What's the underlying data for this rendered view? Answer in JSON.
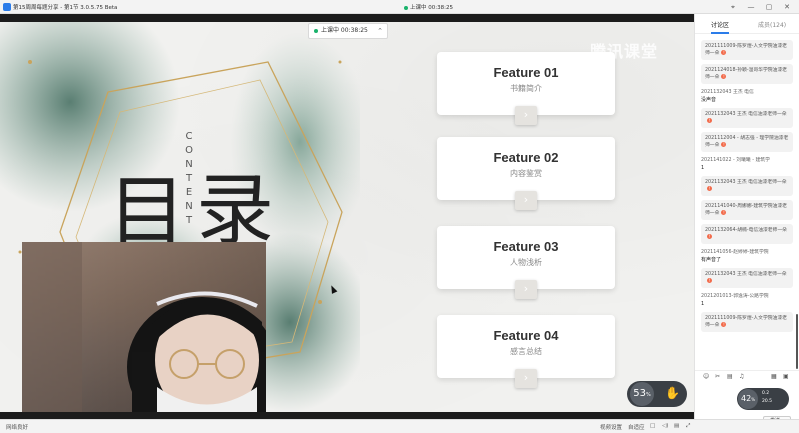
{
  "titlebar": {
    "title": "第15周周每题分享 - 第1节  3.0.5.75 Beta",
    "status": "上课中 00:38:25",
    "controls": [
      "⌖",
      "—",
      "▢",
      "✕"
    ]
  },
  "slide": {
    "timer": "上课中 00:38:25",
    "vertical_text": [
      "C",
      "O",
      "N",
      "T",
      "E",
      "N",
      "T"
    ],
    "big_chars": [
      "目",
      "录"
    ],
    "watermark": "腾讯课堂",
    "features": [
      {
        "title": "Feature 01",
        "subtitle": "书籍简介"
      },
      {
        "title": "Feature 02",
        "subtitle": "内容鉴赏"
      },
      {
        "title": "Feature 03",
        "subtitle": "人物浅析"
      },
      {
        "title": "Feature 04",
        "subtitle": "感言总结"
      }
    ]
  },
  "panel": {
    "tabs": [
      "讨论区",
      "成员(124)"
    ],
    "messages": [
      {
        "kind": "bubble",
        "text": "2021111009-陈罗煜-人文学院油漆老师一朵",
        "warn": true
      },
      {
        "kind": "bubble",
        "text": "2021124018-孙颖-温哥华学院油漆老师一朵",
        "warn": true
      },
      {
        "kind": "name",
        "text": "2021132043 王杰 电信"
      },
      {
        "kind": "plain",
        "text": "没声音"
      },
      {
        "kind": "bubble",
        "text": "2021132043 王杰 电信油漆老师一朵",
        "warn": true
      },
      {
        "kind": "bubble",
        "text": "2021112004 - 胡志强 - 理学院油漆老师一朵",
        "warn": true
      },
      {
        "kind": "name",
        "text": "2021141022 - 刘曦曦 - 建筑学"
      },
      {
        "kind": "plain",
        "text": "1"
      },
      {
        "kind": "bubble",
        "text": "2021132043 王杰 电信油漆老师一朵",
        "warn": true
      },
      {
        "kind": "bubble",
        "text": "2021141040-周娜娜-建筑学院油漆老师一朵",
        "warn": true
      },
      {
        "kind": "bubble",
        "text": "2021132064-胡楠-电信油漆老师一朵",
        "warn": true
      },
      {
        "kind": "name",
        "text": "2021141056-赵婷婷-建筑学院"
      },
      {
        "kind": "plain",
        "text": "有声音了"
      },
      {
        "kind": "bubble",
        "text": "2021132043 王杰 电信油漆老师一朵",
        "warn": true
      },
      {
        "kind": "name",
        "text": "2021201013-郭逸涛-公路学院"
      },
      {
        "kind": "plain",
        "text": "1"
      },
      {
        "kind": "bubble",
        "text": "2021111009-陈罗煜-人文学院油漆老师一朵",
        "warn": true
      }
    ],
    "tools": [
      "☺",
      "✂",
      "▤",
      "♫",
      "▦",
      "▣"
    ],
    "progress_count": "42",
    "progress_unit": "%",
    "stat_up": "0.2",
    "stat_down": "20.5",
    "send": "发送"
  },
  "floating": {
    "count": "53",
    "count_unit": "%"
  },
  "statusbar": {
    "network": "网络良好",
    "items": [
      "视频设置",
      "自适应",
      "□",
      "◁)",
      "▤",
      "⤢"
    ]
  }
}
